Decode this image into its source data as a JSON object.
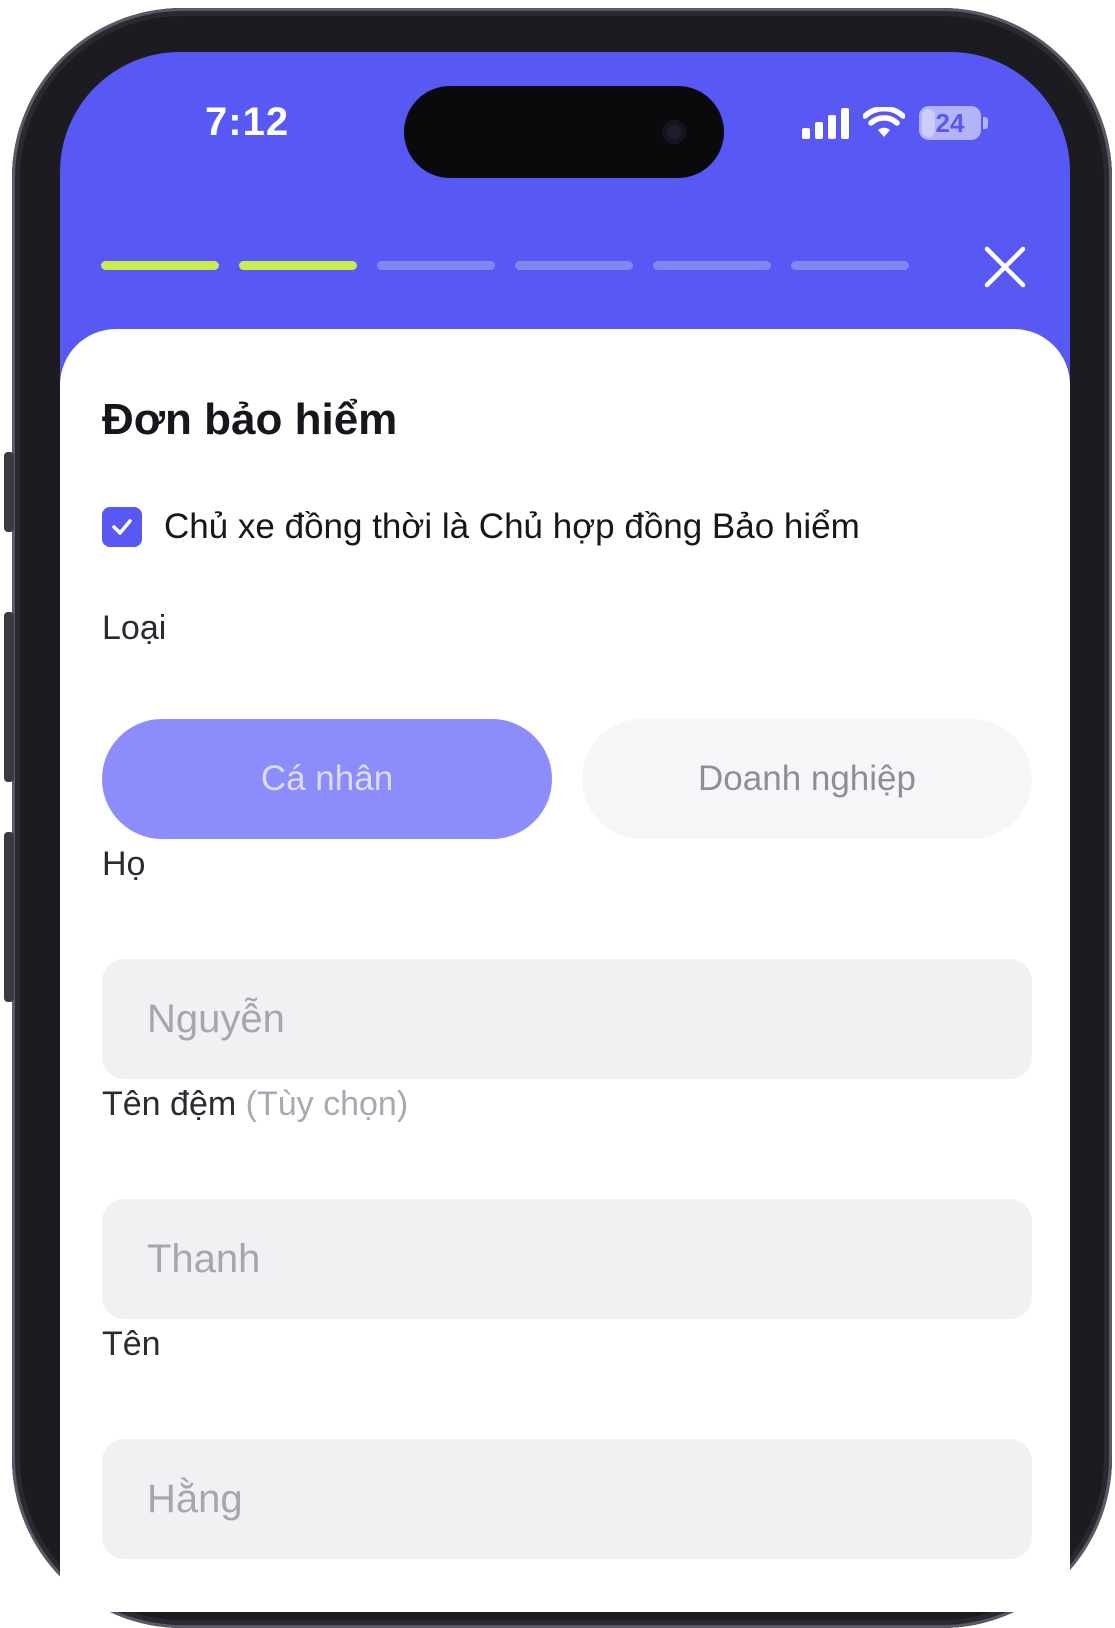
{
  "status_bar": {
    "time": "7:12",
    "battery": "24",
    "battery_level": 0.24
  },
  "progress": {
    "total_steps": 6,
    "completed_steps": 2,
    "completed_color": "#c9ec4e",
    "pending_color": "#8088f0"
  },
  "header": {
    "background_color": "#5858f5",
    "close_icon": "close-icon"
  },
  "form": {
    "title": "Đơn bảo hiểm",
    "owner_checkbox": {
      "label": "Chủ xe đồng thời là Chủ hợp đồng Bảo hiểm",
      "checked": true
    },
    "type": {
      "label": "Loại",
      "options": [
        "Cá nhân",
        "Doanh nghiệp"
      ],
      "selected": "Cá nhân"
    },
    "last_name": {
      "label": "Họ",
      "placeholder": "Nguyễn"
    },
    "middle_name": {
      "label": "Tên đệm",
      "optional_note": "(Tùy chọn)",
      "placeholder": "Thanh"
    },
    "first_name": {
      "label": "Tên",
      "placeholder": "Hằng"
    }
  }
}
